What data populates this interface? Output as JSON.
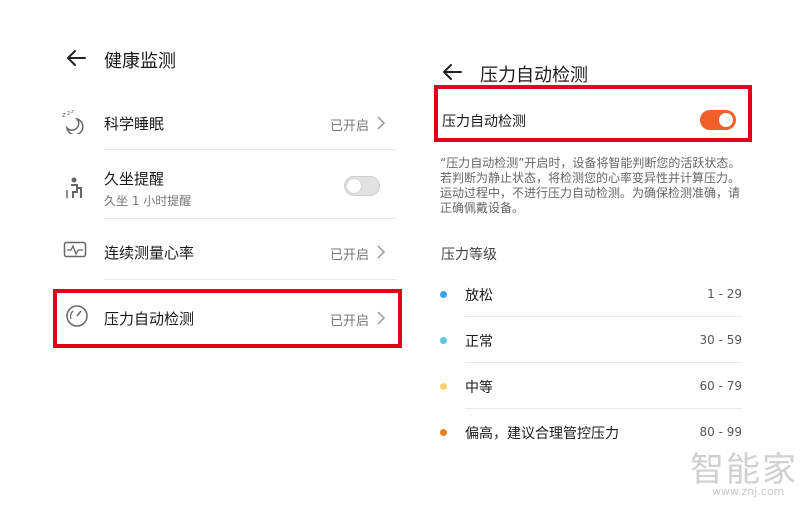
{
  "left": {
    "title": "健康监测",
    "items": [
      {
        "label": "科学睡眠",
        "value": "已开启",
        "icon": "sleep-icon"
      },
      {
        "label": "久坐提醒",
        "sub": "久坐 1 小时提醒",
        "icon": "sedentary-icon",
        "toggle": false
      },
      {
        "label": "连续测量心率",
        "value": "已开启",
        "icon": "heart-rate-icon"
      },
      {
        "label": "压力自动检测",
        "value": "已开启",
        "icon": "gauge-icon"
      }
    ]
  },
  "right": {
    "title": "压力自动检测",
    "toggle_label": "压力自动检测",
    "toggle_on": true,
    "description": "“压力自动检测”开启时，设备将智能判断您的活跃状态。若判断为静止状态，将检测您的心率变异性并计算压力。运动过程中，不进行压力自动检测。为确保检测准确，请正确佩戴设备。",
    "levels_title": "压力等级",
    "levels": [
      {
        "label": "放松",
        "range": "1 - 29",
        "color": "#3aa0e8"
      },
      {
        "label": "正常",
        "range": "30 - 59",
        "color": "#5cc8e0"
      },
      {
        "label": "中等",
        "range": "60 - 79",
        "color": "#f7d36a"
      },
      {
        "label": "偏高，建议合理管控压力",
        "range": "80 - 99",
        "color": "#ee7a1b"
      }
    ]
  },
  "watermark": {
    "text": "智能家",
    "url": "www.znj.com"
  },
  "colors": {
    "highlight": "#e3001b",
    "toggle_on": "#f0602b"
  }
}
